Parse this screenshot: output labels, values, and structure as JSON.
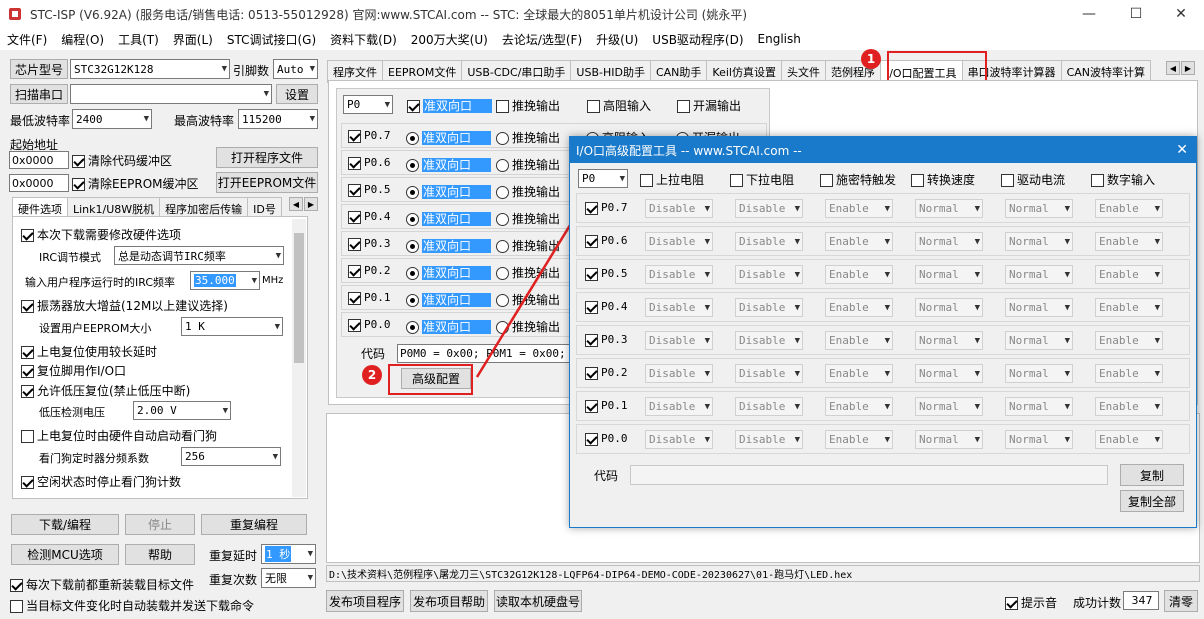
{
  "window": {
    "title": "STC-ISP (V6.92A) (服务电话/销售电话: 0513-55012928) 官网:www.STCAI.com  -- STC: 全球最大的8051单片机设计公司 (姚永平)",
    "min": "—",
    "max": "☐",
    "close": "✕"
  },
  "menu": [
    "文件(F)",
    "编程(O)",
    "工具(T)",
    "界面(L)",
    "STC调试接口(G)",
    "资料下载(D)",
    "200万大奖(U)",
    "去论坛/选型(F)",
    "升级(U)",
    "USB驱动程序(D)",
    "English"
  ],
  "left": {
    "chip_type_btn": "芯片型号",
    "chip_type": "STC32G12K128",
    "pin_label": "引脚数",
    "pin_value": "Auto",
    "scan_btn": "扫描串口",
    "port_value": "",
    "settings_btn": "设置",
    "min_baud_label": "最低波特率",
    "min_baud": "2400",
    "max_baud_label": "最高波特率",
    "max_baud": "115200",
    "start_addr_label": "起始地址",
    "addr1": "0x0000",
    "clear_code": "清除代码缓冲区",
    "open_prog_btn": "打开程序文件",
    "addr2": "0x0000",
    "clear_eeprom": "清除EEPROM缓冲区",
    "open_eeprom_btn": "打开EEPROM文件",
    "hw_tabs": [
      "硬件选项",
      "Link1/U8W脱机",
      "程序加密后传输",
      "ID号"
    ],
    "hw": {
      "opt1": "本次下载需要修改硬件选项",
      "irc_mode_label": "IRC调节模式",
      "irc_mode": "总是动态调节IRC频率",
      "irc_freq_label": "输入用户程序运行时的IRC频率",
      "irc_freq": "35.000",
      "irc_unit": "MHz",
      "opt2": "振荡器放大增益(12M以上建议选择)",
      "eeprom_label": "设置用户EEPROM大小",
      "eeprom_size": "1    K",
      "opt3": "上电复位使用较长延时",
      "opt4": "复位脚用作I/O口",
      "opt5": "允许低压复位(禁止低压中断)",
      "lv_label": "低压检测电压",
      "lv_value": "2.00 V",
      "opt6": "上电复位时由硬件自动启动看门狗",
      "wdt_label": "看门狗定时器分频系数",
      "wdt_value": "256",
      "opt7": "空闲状态时停止看门狗计数"
    },
    "download_btn": "下载/编程",
    "stop_btn": "停止",
    "reprogram_btn": "重复编程",
    "detect_btn": "检测MCU选项",
    "help_btn": "帮助",
    "repeat_delay_label": "重复延时",
    "repeat_delay": "1 秒",
    "reload_label": "每次下载前都重新装载目标文件",
    "repeat_count_label": "重复次数",
    "repeat_count": "无限",
    "auto_send_label": "当目标文件变化时自动装载并发送下载命令"
  },
  "main_tabs": [
    "程序文件",
    "EEPROM文件",
    "USB-CDC/串口助手",
    "USB-HID助手",
    "CAN助手",
    "Keil仿真设置",
    "头文件",
    "范例程序",
    "I/O口配置工具",
    "串口波特率计算器",
    "CAN波特率计算"
  ],
  "io": {
    "port": "P0",
    "modes": [
      "准双向口",
      "推挽输出",
      "高阻输入",
      "开漏输出"
    ],
    "pins": [
      "P0.7",
      "P0.6",
      "P0.5",
      "P0.4",
      "P0.3",
      "P0.2",
      "P0.1",
      "P0.0"
    ],
    "code_label": "代码",
    "code": "P0M0 = 0x00; P0M1 = 0x00;",
    "adv_btn": "高级配置"
  },
  "status": {
    "path": "D:\\技术资料\\范例程序\\屠龙刀三\\STC32G12K128-LQFP64-DIP64-DEMO-CODE-20230627\\01-跑马灯\\LED.hex",
    "publish_btn": "发布项目程序",
    "publish_help_btn": "发布项目帮助",
    "read_hd_btn": "读取本机硬盘号",
    "sound_label": "提示音",
    "count_label": "成功计数",
    "count": "347",
    "clear_btn": "清零"
  },
  "dialog": {
    "title": "I/O口高级配置工具 -- www.STCAI.com --",
    "close": "✕",
    "port": "P0",
    "headers": [
      "上拉电阻",
      "下拉电阻",
      "施密特触发",
      "转换速度",
      "驱动电流",
      "数字输入"
    ],
    "values": [
      "Disable",
      "Disable",
      "Enable",
      "Normal",
      "Normal",
      "Enable"
    ],
    "code_label": "代码",
    "copy_btn": "复制",
    "copy_all_btn": "复制全部"
  },
  "badges": [
    "1",
    "2"
  ],
  "colors": {
    "accent": "#1979ca",
    "highlight": "#3399ff",
    "marker": "#e02020"
  }
}
